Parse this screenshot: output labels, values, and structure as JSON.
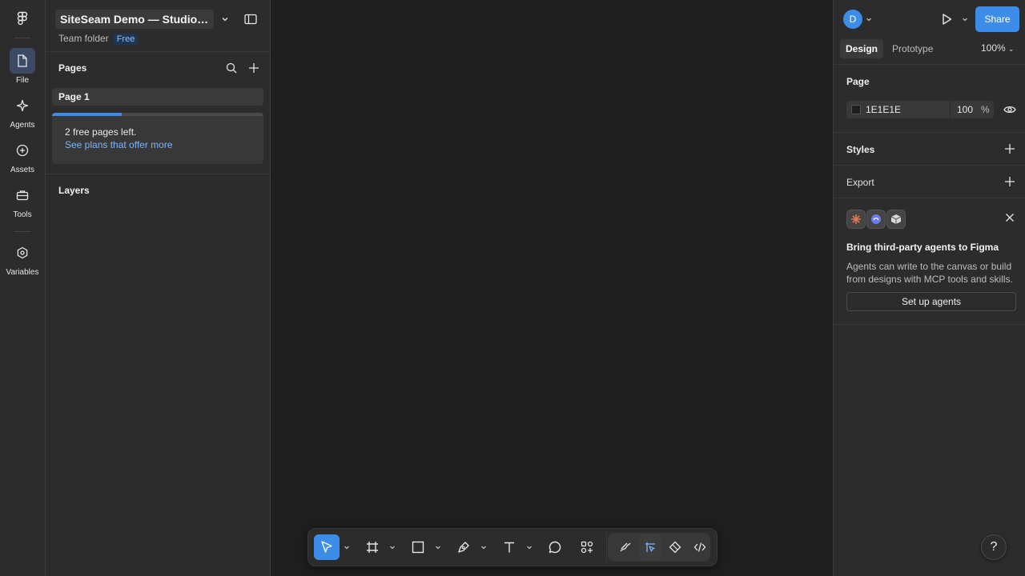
{
  "rail": {
    "items": [
      {
        "label": "File",
        "icon": "file-icon",
        "active": true
      },
      {
        "label": "Agents",
        "icon": "sparkle-icon",
        "active": false
      },
      {
        "label": "Assets",
        "icon": "plus-circle-icon",
        "active": false
      },
      {
        "label": "Tools",
        "icon": "toolbox-icon",
        "active": false
      },
      {
        "label": "Variables",
        "icon": "hexagon-icon",
        "active": false
      }
    ]
  },
  "file": {
    "name": "SiteSeam Demo — Studio C...",
    "team": "Team folder",
    "plan_badge": "Free"
  },
  "pages": {
    "title": "Pages",
    "items": [
      "Page 1"
    ],
    "promo_line1": "2 free pages left.",
    "promo_link": "See plans that offer more",
    "promo_progress": 0.33
  },
  "layers": {
    "title": "Layers"
  },
  "header": {
    "avatar_initial": "D",
    "share_label": "Share"
  },
  "tabs": {
    "design": "Design",
    "prototype": "Prototype",
    "zoom": "100%"
  },
  "page_props": {
    "title": "Page",
    "color_hex": "1E1E1E",
    "opacity": "100",
    "opacity_unit": "%"
  },
  "styles": {
    "title": "Styles"
  },
  "export": {
    "title": "Export"
  },
  "promo_agents": {
    "title": "Bring third-party agents to Figma",
    "desc": "Agents can write to the canvas or build from designs with MCP tools and skills.",
    "button": "Set up agents"
  },
  "help": {
    "label": "?"
  },
  "colors": {
    "accent": "#3d8de8",
    "panel": "#2c2c2c",
    "canvas": "#1e1e1e"
  },
  "toolbar": {
    "tools": [
      "move-tool",
      "frame-tool",
      "rectangle-tool",
      "pen-tool",
      "text-tool",
      "comment-tool",
      "actions-tool",
      "draw-mode",
      "design-mode",
      "dev-components",
      "dev-mode"
    ]
  }
}
